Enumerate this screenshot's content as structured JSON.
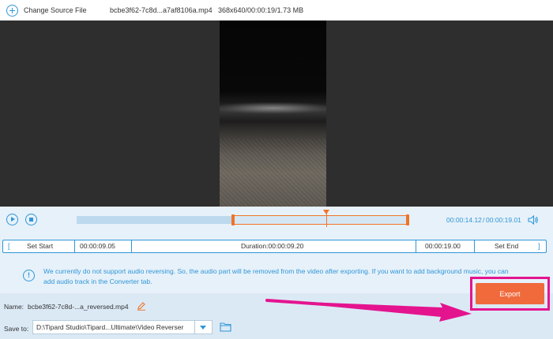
{
  "topbar": {
    "change_source_label": "Change Source File",
    "file_name": "bcbe3f62-7c8d...a7af8106a.mp4",
    "file_info": "368x640/00:00:19/1.73 MB"
  },
  "controls": {
    "time_current": "00:00:14.12",
    "time_separator": "/",
    "time_total": "00:00:19.01",
    "selection_start_fraction": 0.47,
    "selection_end_fraction": 1.0,
    "playhead_fraction": 0.753
  },
  "trim": {
    "left_bracket": "[",
    "set_start_label": "Set Start",
    "start_time": "00:00:09.05",
    "duration_label": "Duration:00:00:09.20",
    "end_time": "00:00:19.00",
    "set_end_label": "Set End",
    "right_bracket": "]"
  },
  "notice": {
    "icon_text": "!",
    "text": "We currently do not support audio reversing. So, the audio part will be removed from the video after exporting. If you want to add background music, you can add audio track in the Converter tab."
  },
  "output": {
    "name_label": "Name:",
    "name_value": "bcbe3f62-7c8d-...a_reversed.mp4",
    "save_to_label": "Save to:",
    "save_to_value": "D:\\Tipard Studio\\Tipard...Ultimate\\Video Reverser",
    "export_label": "Export"
  },
  "icons": {
    "add": "plus-circle-icon",
    "play": "play-icon",
    "stop": "stop-icon",
    "volume": "volume-icon",
    "info": "info-icon",
    "edit": "pencil-icon",
    "dropdown": "chevron-down-icon",
    "folder": "folder-icon"
  },
  "colors": {
    "accent": "#2f96d8",
    "trim_handle": "#f07427",
    "export_button": "#f06a3c",
    "annotation": "#e4148f"
  }
}
